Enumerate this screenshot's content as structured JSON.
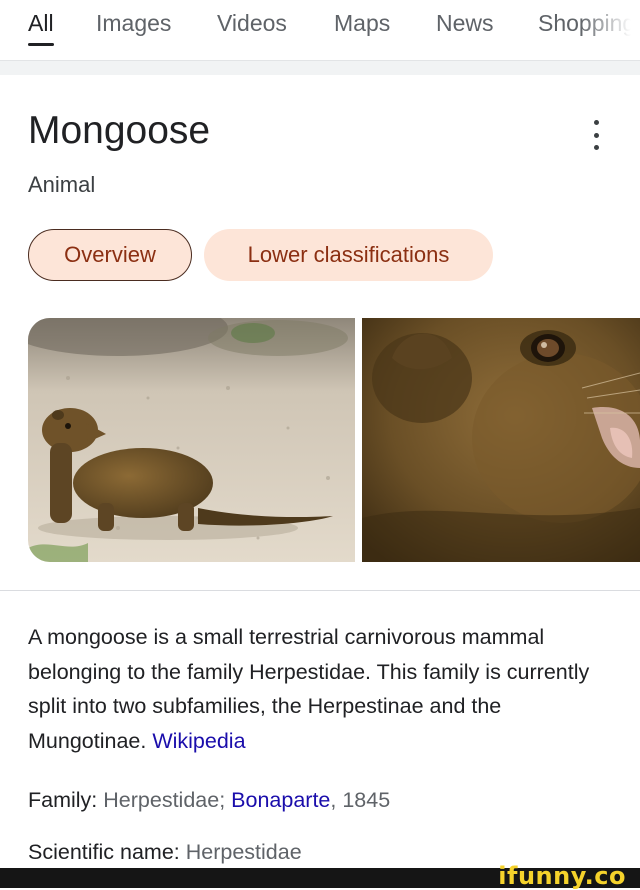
{
  "tabs": [
    {
      "label": "All",
      "active": true
    },
    {
      "label": "Images",
      "active": false
    },
    {
      "label": "Videos",
      "active": false
    },
    {
      "label": "Maps",
      "active": false
    },
    {
      "label": "News",
      "active": false
    },
    {
      "label": "Shopping",
      "active": false
    }
  ],
  "panel": {
    "title": "Mongoose",
    "subtitle": "Animal",
    "menu_icon": "more-vert-icon",
    "chips": {
      "overview": "Overview",
      "lower": "Lower classifications"
    },
    "images": [
      {
        "alt": "mongoose-on-sand-photo"
      },
      {
        "alt": "mongoose-face-closeup-photo"
      }
    ],
    "description": {
      "text": "A mongoose is a small terrestrial carnivorous mammal belonging to the family Herpestidae. This family is currently split into two subfamilies, the Herpestinae and the Mungotinae.",
      "source": "Wikipedia"
    },
    "facts": {
      "family": {
        "label": "Family:",
        "value_prefix": "Herpestidae;",
        "link": "Bonaparte",
        "value_suffix": ", 1845"
      },
      "scientific_name": {
        "label": "Scientific name:",
        "value": "Herpestidae"
      }
    }
  },
  "watermark": {
    "text": "ifunny.co"
  },
  "colors": {
    "chip_bg": "#fde5d8",
    "chip_text": "#8b2f12",
    "link": "#1a0dab",
    "muted": "#5f6368",
    "watermark_yellow": "#f5d22b"
  }
}
